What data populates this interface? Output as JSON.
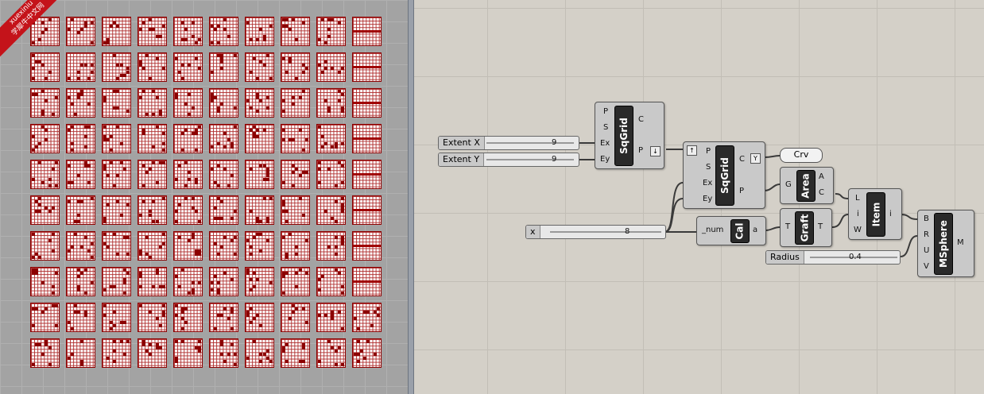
{
  "watermark": {
    "line1": "xuexiniu",
    "line2": "学犀牛中文网"
  },
  "viewport": {
    "rows": 10,
    "cols": 10
  },
  "components": {
    "sqgrid1": {
      "name": "SqGrid",
      "inputs": [
        "P",
        "S",
        "Ex",
        "Ey"
      ],
      "outputs": [
        "C",
        "P"
      ]
    },
    "sqgrid2": {
      "name": "SqGrid",
      "inputs": [
        "P",
        "S",
        "Ex",
        "Ey"
      ],
      "outputs": [
        "C",
        "P"
      ]
    },
    "area": {
      "name": "Area",
      "inputs": [
        "G"
      ],
      "outputs": [
        "A",
        "C"
      ]
    },
    "calc": {
      "name": "Cal",
      "inputs": [
        "_num"
      ],
      "outputs": [
        "a"
      ]
    },
    "graft": {
      "name": "Graft",
      "inputs": [
        "T"
      ],
      "outputs": [
        "T"
      ]
    },
    "item": {
      "name": "Item",
      "inputs": [
        "L",
        "i",
        "W"
      ],
      "outputs": [
        "i"
      ]
    },
    "msphere": {
      "name": "MSphere",
      "inputs": [
        "B",
        "R",
        "U",
        "V"
      ],
      "outputs": [
        "M"
      ]
    },
    "crv_panel": "Crv"
  },
  "sliders": {
    "extent_x": {
      "label": "Extent X",
      "value": "9"
    },
    "extent_y": {
      "label": "Extent Y",
      "value": "9"
    },
    "x": {
      "label": "x",
      "value": "8"
    },
    "radius": {
      "label": "Radius",
      "value": "0.4"
    }
  },
  "colors": {
    "tile_red": "#8b0000",
    "viewport_bg": "#a3a3a3",
    "canvas_bg": "#d4d0c8"
  }
}
